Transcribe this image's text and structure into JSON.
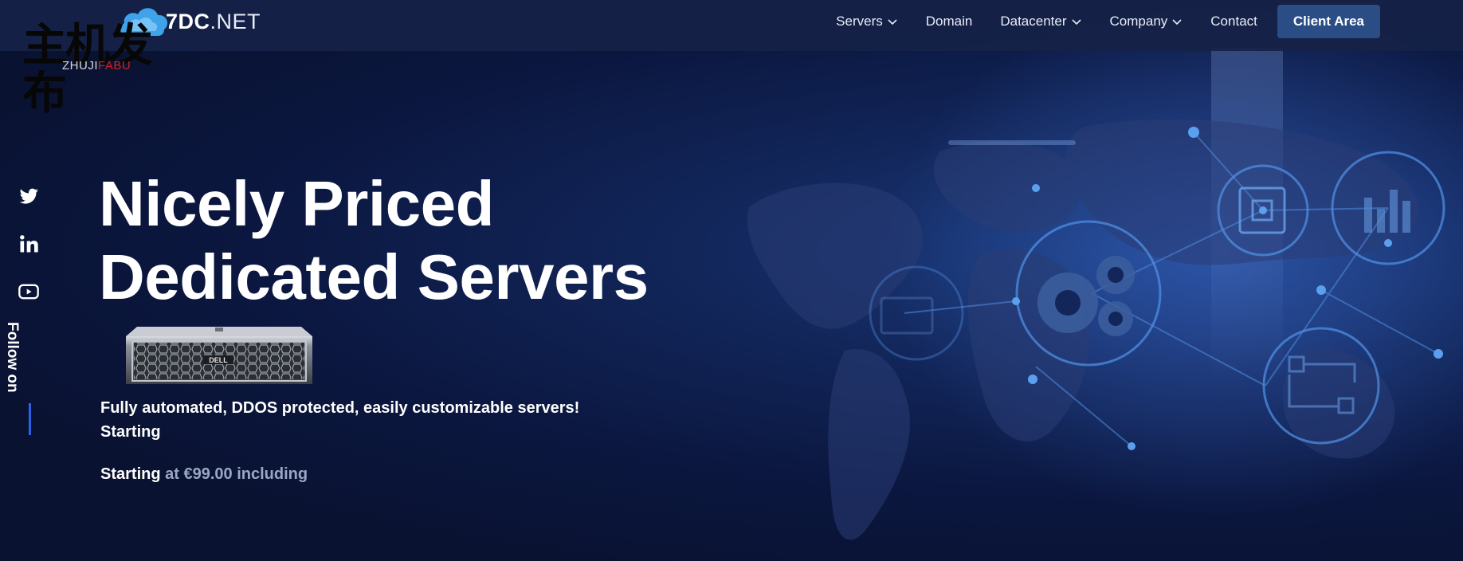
{
  "brand": {
    "logo_name": "7DC",
    "logo_suffix": ".NET",
    "watermark_cn": "主机发布",
    "watermark_en_a": "ZHUJI",
    "watermark_en_b": "FABU"
  },
  "nav": {
    "items": [
      {
        "label": "Servers",
        "has_dropdown": true
      },
      {
        "label": "Domain",
        "has_dropdown": false
      },
      {
        "label": "Datacenter",
        "has_dropdown": true
      },
      {
        "label": "Company",
        "has_dropdown": true
      },
      {
        "label": "Contact",
        "has_dropdown": false
      }
    ],
    "cta_label": "Client Area"
  },
  "social": {
    "icons": [
      "twitter-icon",
      "linkedin-icon",
      "youtube-icon"
    ],
    "follow_label": "Follow on"
  },
  "hero": {
    "title_line1": "Nicely Priced",
    "title_line2": "Dedicated Servers",
    "server_brand": "DELL",
    "subtitle_line1": "Fully automated, DDOS protected, easily customizable servers!",
    "subtitle_line2": "Starting",
    "price_prefix": "Starting",
    "price_rest": "at €99.00 including"
  },
  "colors": {
    "background": "#0a1231",
    "header": "#162246",
    "cta": "#2a4d86",
    "accent_line": "#2e62e8",
    "muted_text": "#9aa7c4"
  }
}
